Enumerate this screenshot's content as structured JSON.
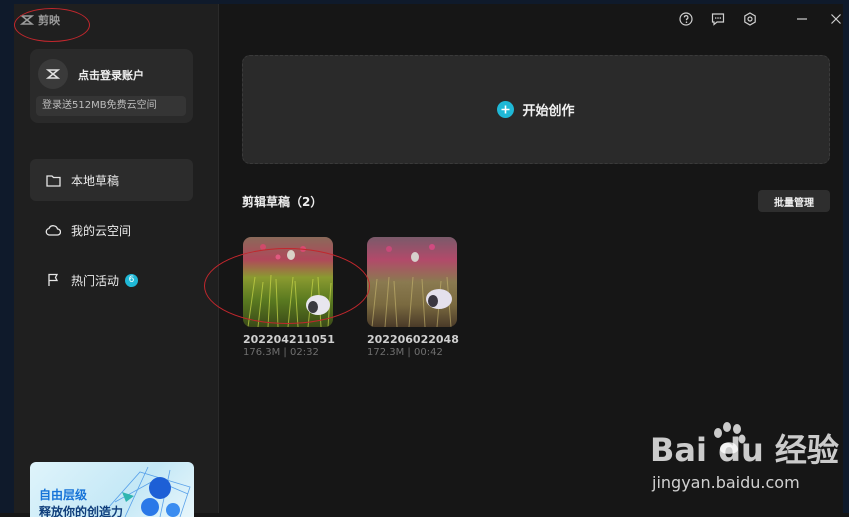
{
  "app": {
    "name": "剪映"
  },
  "account": {
    "login_label": "点击登录账户",
    "storage_promo": "登录送512MB免费云空间"
  },
  "nav": [
    {
      "label": "本地草稿",
      "icon": "folder-icon",
      "active": true
    },
    {
      "label": "我的云空间",
      "icon": "cloud-icon",
      "active": false
    },
    {
      "label": "热门活动",
      "icon": "flag-icon",
      "active": false,
      "badge": "6"
    }
  ],
  "promo": {
    "line1": "自由层级",
    "line2": "释放你的创造力"
  },
  "titlebar": {
    "icons": [
      "help-icon",
      "feedback-icon",
      "settings-icon",
      "minimize-icon",
      "close-icon"
    ]
  },
  "create": {
    "label": "开始创作"
  },
  "drafts": {
    "title": "剪辑草稿（2）",
    "batch_label": "批量管理",
    "items": [
      {
        "name": "202204211051",
        "meta": "176.3M | 02:32"
      },
      {
        "name": "202206022048",
        "meta": "172.3M | 00:42"
      }
    ]
  },
  "watermark": {
    "brand": "Bai du 经验",
    "url": "jingyan.baidu.com"
  },
  "colors": {
    "accent": "#1fb8d6",
    "annotation": "#c1272d",
    "sidebar": "#1f1f1f",
    "main": "#161616"
  }
}
